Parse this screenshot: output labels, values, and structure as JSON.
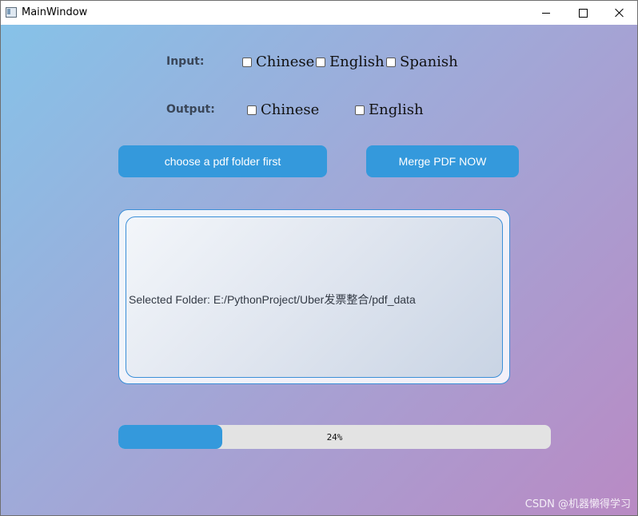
{
  "window": {
    "title": "MainWindow",
    "controls": {
      "minimize_icon": "minimize-icon",
      "maximize_icon": "maximize-icon",
      "close_icon": "close-icon"
    }
  },
  "input": {
    "label": "Input:",
    "options": [
      {
        "label": "Chinese",
        "checked": false
      },
      {
        "label": "English",
        "checked": false
      },
      {
        "label": "Spanish",
        "checked": false
      }
    ]
  },
  "output": {
    "label": "Output:",
    "options": [
      {
        "label": "Chinese",
        "checked": false
      },
      {
        "label": "English",
        "checked": false
      }
    ]
  },
  "buttons": {
    "choose": "choose a pdf folder first",
    "merge": "Merge PDF NOW"
  },
  "folder": {
    "text": "Selected Folder: E:/PythonProject/Uber发票整合/pdf_data"
  },
  "progress": {
    "value": 24,
    "text": "24%"
  },
  "watermark": "CSDN @机器懒得学习",
  "colors": {
    "accent": "#3499dc",
    "frame_border": "#3b8fd8"
  }
}
